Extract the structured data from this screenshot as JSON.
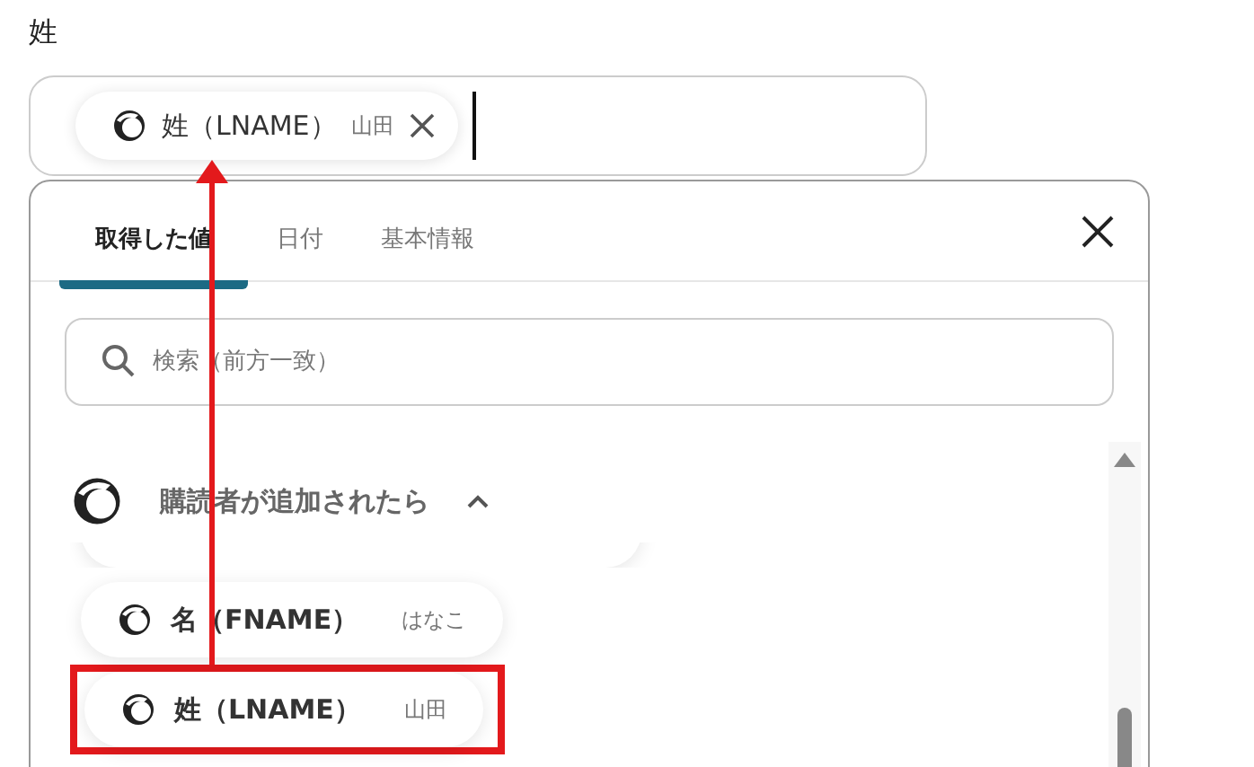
{
  "field": {
    "label": "姓",
    "chip": {
      "label": "姓（LNAME）",
      "value": "山田"
    }
  },
  "popup": {
    "tabs": [
      {
        "label": "取得した値",
        "selected": true
      },
      {
        "label": "日付",
        "selected": false
      },
      {
        "label": "基本情報",
        "selected": false
      }
    ],
    "search": {
      "placeholder": "検索（前方一致）"
    },
    "group": {
      "title": "購読者が追加されたら",
      "expanded": true
    },
    "items": [
      {
        "kind": "clipped"
      },
      {
        "kind": "item",
        "label": "名（FNAME）",
        "value": "はなこ",
        "highlighted": false
      },
      {
        "kind": "item",
        "label": "姓（LNAME）",
        "value": "山田",
        "highlighted": true
      }
    ]
  }
}
